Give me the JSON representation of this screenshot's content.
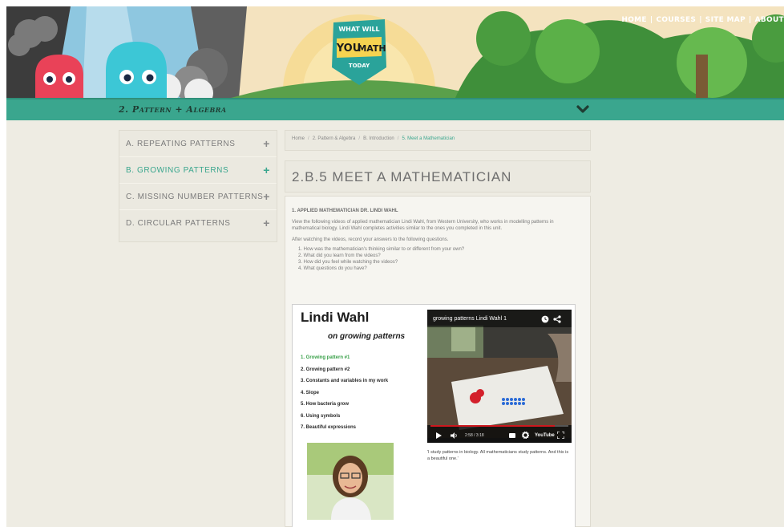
{
  "header": {
    "logo": "WHAT WILL YOU DO WITH MATH TODAY",
    "logo_lines": [
      "WHAT WILL",
      "YOU",
      "MATH",
      "TODAY"
    ],
    "nav": [
      "HOME",
      "COURSES",
      "SITE MAP",
      "ABOUT"
    ]
  },
  "unit_bar": {
    "title": "2. Pattern + Algebra"
  },
  "sidebar": {
    "items": [
      {
        "label": "A. REPEATING PATTERNS",
        "active": false
      },
      {
        "label": "B. GROWING PATTERNS",
        "active": true
      },
      {
        "label": "C. MISSING NUMBER PATTERNS",
        "active": false
      },
      {
        "label": "D. CIRCULAR PATTERNS",
        "active": false
      }
    ]
  },
  "breadcrumb": [
    "Home",
    "2. Pattern & Algebra",
    "B. Introduction",
    "5. Meet a Mathematician"
  ],
  "page_title": "2.B.5 MEET A MATHEMATICIAN",
  "content": {
    "section_heading": "1. APPLIED MATHEMATICIAN DR. LINDI WAHL",
    "intro": "View the following videos of applied mathematician Lindi Wahl, from Western University, who works in modelling patterns in mathematical biology. Lindi Wahl completes activities similar to the ones you completed in this unit.",
    "after": "After watching the videos, record your answers to the following questions.",
    "questions": [
      "1. How was the mathematician's thinking similar to or different from your own?",
      "2. What did you learn from the videos?",
      "3. How did you feel while watching the videos?",
      "4. What questions do you have?"
    ]
  },
  "card": {
    "name": "Lindi Wahl",
    "subtitle": "on growing patterns",
    "topics": [
      "1. Growing pattern #1",
      "2. Growing pattern #2",
      "3. Constants and variables in my work",
      "4. Slope",
      "5. How bacteria grow",
      "6. Using symbols",
      "7. Beautiful expressions"
    ],
    "quote": "'I study patterns in biology. All mathematicians study patterns. And this is a beautiful one.'"
  },
  "video": {
    "title": "growing patterns Lindi Wahl 1",
    "time": "2:58 / 3:18",
    "progress": 0.9,
    "brand": "YouTube"
  },
  "colors": {
    "accent": "#3aa68e",
    "active_link": "#3aa14a",
    "progress": "#cc181e"
  }
}
